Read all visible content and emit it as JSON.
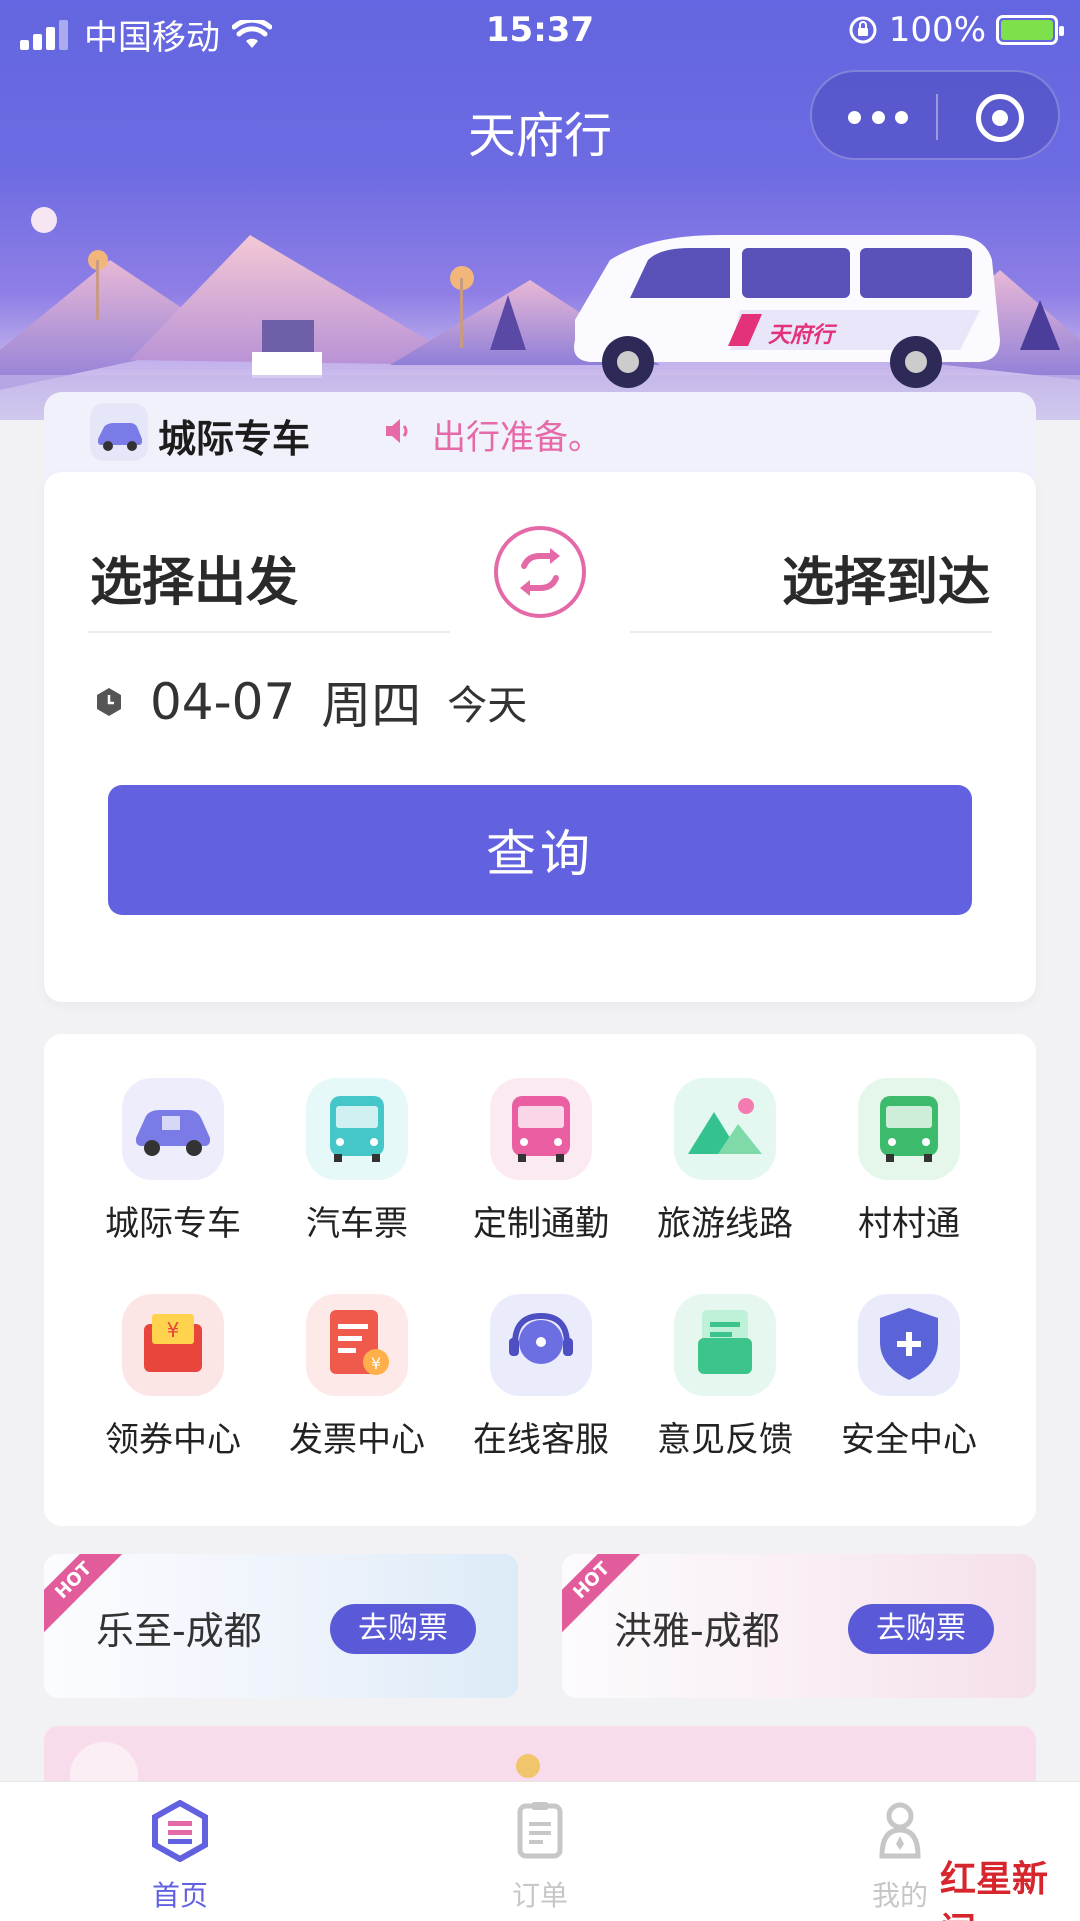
{
  "status_bar": {
    "carrier": "中国移动",
    "time": "15:37",
    "battery": "100%"
  },
  "nav": {
    "title": "天府行",
    "more_icon": "more-dots-icon",
    "close_icon": "target-circle-icon"
  },
  "banner": {
    "van_brand": "天府行"
  },
  "booking": {
    "tab_label": "城际专车",
    "notice": "出行准备。",
    "from_placeholder": "选择出发",
    "to_placeholder": "选择到达",
    "date": "04-07",
    "weekday": "周四",
    "day_tag": "今天",
    "query_label": "查询"
  },
  "services": [
    {
      "label": "城际专车",
      "icon": "intercity-car-icon",
      "color": "#7a7be6"
    },
    {
      "label": "汽车票",
      "icon": "bus-ticket-icon",
      "color": "#45c7c9"
    },
    {
      "label": "定制通勤",
      "icon": "commute-bus-icon",
      "color": "#ea5fa2"
    },
    {
      "label": "旅游线路",
      "icon": "mountain-icon",
      "color": "#34c28f"
    },
    {
      "label": "村村通",
      "icon": "village-bus-icon",
      "color": "#3dbb6c"
    },
    {
      "label": "领券中心",
      "icon": "coupon-icon",
      "color": "#e8453c"
    },
    {
      "label": "发票中心",
      "icon": "invoice-icon",
      "color": "#ef5a4d"
    },
    {
      "label": "在线客服",
      "icon": "headset-icon",
      "color": "#6c6fe2"
    },
    {
      "label": "意见反馈",
      "icon": "feedback-icon",
      "color": "#3cc48a"
    },
    {
      "label": "安全中心",
      "icon": "shield-icon",
      "color": "#5b63d8"
    }
  ],
  "promos": [
    {
      "badge": "HOT",
      "route": "乐至-成都",
      "button": "去购票"
    },
    {
      "badge": "HOT",
      "route": "洪雅-成都",
      "button": "去购票"
    }
  ],
  "bottom_tabs": [
    {
      "label": "首页",
      "icon": "home-icon",
      "active": true
    },
    {
      "label": "订单",
      "icon": "order-icon",
      "active": false
    },
    {
      "label": "我的",
      "icon": "profile-icon",
      "active": false
    }
  ],
  "watermark": {
    "text": "红星新闻"
  },
  "colors": {
    "primary": "#6262e0",
    "accent_pink": "#e46aa7",
    "inactive": "#c7c7c7"
  }
}
